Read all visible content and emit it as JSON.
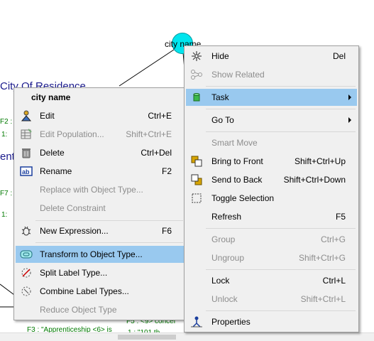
{
  "background": {
    "node_label": "city name",
    "city_residence": "City Of Residence",
    "ent_fragment": "enti",
    "f2": "F2 :",
    "one_a": "1:",
    "f7": "F7 :",
    "one_b": "1:",
    "f3_text": "F3 : \"Apprenticeship <6> is",
    "f5_text": "F5 : <9> concer",
    "bottom_fragment": "1 : \"101 th"
  },
  "left_menu": {
    "header": "city name",
    "items": [
      {
        "label": "Edit",
        "shortcut": "Ctrl+E",
        "icon": "edit-person-icon",
        "disabled": false
      },
      {
        "label": "Edit Population...",
        "shortcut": "Shift+Ctrl+E",
        "icon": "table-icon",
        "disabled": true
      },
      {
        "label": "Delete",
        "shortcut": "Ctrl+Del",
        "icon": "trash-icon",
        "disabled": false
      },
      {
        "label": "Rename",
        "shortcut": "F2",
        "icon": "rename-icon",
        "disabled": false
      },
      {
        "label": "Replace with Object Type...",
        "shortcut": "",
        "icon": "",
        "disabled": true
      },
      {
        "label": "Delete Constraint",
        "shortcut": "",
        "icon": "",
        "disabled": true
      },
      {
        "label": "New Expression...",
        "shortcut": "F6",
        "icon": "bug-icon",
        "disabled": false
      },
      {
        "label": "Transform to Object Type...",
        "shortcut": "",
        "icon": "transform-icon",
        "disabled": false,
        "highlighted": true
      },
      {
        "label": "Split Label Type...",
        "shortcut": "",
        "icon": "split-icon",
        "disabled": false
      },
      {
        "label": "Combine Label Types...",
        "shortcut": "",
        "icon": "combine-icon",
        "disabled": false
      },
      {
        "label": "Reduce Object Type",
        "shortcut": "",
        "icon": "",
        "disabled": true
      }
    ]
  },
  "right_menu": {
    "items": [
      {
        "label": "Hide",
        "shortcut": "Del",
        "icon": "hide-icon",
        "disabled": false
      },
      {
        "label": "Show Related",
        "shortcut": "",
        "icon": "related-icon",
        "disabled": true
      },
      {
        "label": "Task",
        "shortcut": "",
        "icon": "cylinder-icon",
        "disabled": false,
        "highlighted": true,
        "submenu": true
      },
      {
        "label": "Go To",
        "shortcut": "",
        "icon": "",
        "disabled": false,
        "submenu": true
      },
      {
        "label": "Smart Move",
        "shortcut": "",
        "icon": "",
        "disabled": true
      },
      {
        "label": "Bring to Front",
        "shortcut": "Shift+Ctrl+Up",
        "icon": "bring-front-icon",
        "disabled": false
      },
      {
        "label": "Send to Back",
        "shortcut": "Shift+Ctrl+Down",
        "icon": "send-back-icon",
        "disabled": false
      },
      {
        "label": "Toggle Selection",
        "shortcut": "",
        "icon": "selection-icon",
        "disabled": false
      },
      {
        "label": "Refresh",
        "shortcut": "F5",
        "icon": "",
        "disabled": false
      },
      {
        "label": "Group",
        "shortcut": "Ctrl+G",
        "icon": "",
        "disabled": true
      },
      {
        "label": "Ungroup",
        "shortcut": "Shift+Ctrl+G",
        "icon": "",
        "disabled": true
      },
      {
        "label": "Lock",
        "shortcut": "Ctrl+L",
        "icon": "",
        "disabled": false
      },
      {
        "label": "Unlock",
        "shortcut": "Shift+Ctrl+L",
        "icon": "",
        "disabled": true
      },
      {
        "label": "Properties",
        "shortcut": "",
        "icon": "properties-icon",
        "disabled": false
      }
    ]
  },
  "colors": {
    "highlight": "#99c9ef",
    "node_fill": "#00e5ee",
    "green_text": "#007a00",
    "blue_text": "#1a1a8c"
  }
}
